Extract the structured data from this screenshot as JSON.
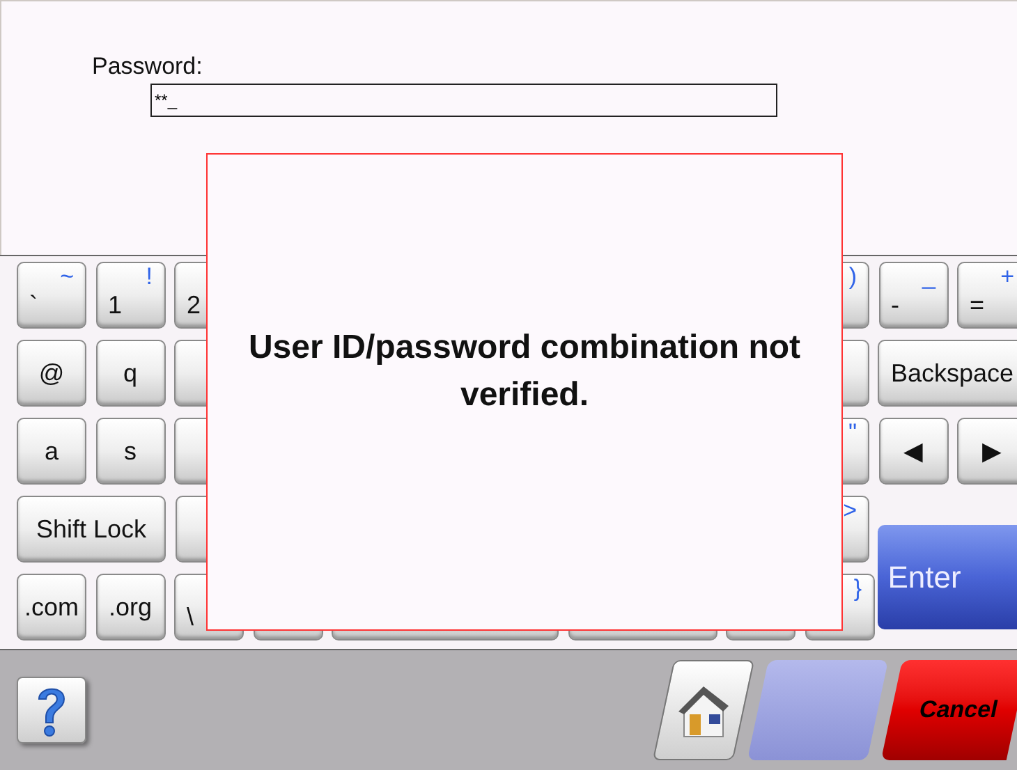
{
  "login": {
    "label": "Password:",
    "value": "**_"
  },
  "keyboard": {
    "rows": [
      {
        "left": [
          {
            "kind": "key",
            "label": "`",
            "shift": "~"
          },
          {
            "kind": "key",
            "label": "1",
            "shift": "!"
          },
          {
            "kind": "dual",
            "label": "2"
          }
        ],
        "right": [
          {
            "kind": "key",
            "shift": ")"
          },
          {
            "kind": "key",
            "label": "-",
            "shift": "_"
          },
          {
            "kind": "key",
            "label": "=",
            "shift": "+"
          }
        ]
      },
      {
        "left": [
          {
            "kind": "key",
            "label": "@"
          },
          {
            "kind": "key",
            "label": "q"
          },
          {
            "kind": "key"
          }
        ],
        "right": [
          {
            "kind": "key"
          },
          {
            "kind": "wide",
            "label": "Backspace"
          }
        ]
      },
      {
        "left": [
          {
            "kind": "key",
            "label": "a"
          },
          {
            "kind": "key",
            "label": "s"
          },
          {
            "kind": "key"
          }
        ],
        "right": [
          {
            "kind": "key",
            "shift": "\""
          },
          {
            "kind": "key",
            "label": "◀"
          },
          {
            "kind": "key",
            "label": "▶"
          }
        ]
      },
      {
        "left": [
          {
            "kind": "wide",
            "label": "Shift Lock"
          },
          {
            "kind": "key"
          }
        ],
        "right": [
          {
            "kind": "key",
            "shift": ">"
          }
        ]
      },
      {
        "left": [
          {
            "kind": "key",
            "label": ".com"
          },
          {
            "kind": "key",
            "label": ".org"
          },
          {
            "kind": "dual",
            "label": "\\"
          },
          {
            "kind": "key"
          },
          {
            "kind": "space"
          },
          {
            "kind": "wide"
          },
          {
            "kind": "key"
          },
          {
            "kind": "key",
            "shift": "}"
          }
        ],
        "right": [
          {
            "kind": "enter",
            "label": "Enter"
          }
        ]
      }
    ]
  },
  "dialog": {
    "message": "User ID/password combination not verified."
  },
  "bottom_bar": {
    "buttons": [
      {
        "kind": "help"
      },
      {
        "kind": "home"
      },
      {
        "kind": "blank"
      },
      {
        "kind": "cancel",
        "label": "Cancel"
      }
    ]
  }
}
